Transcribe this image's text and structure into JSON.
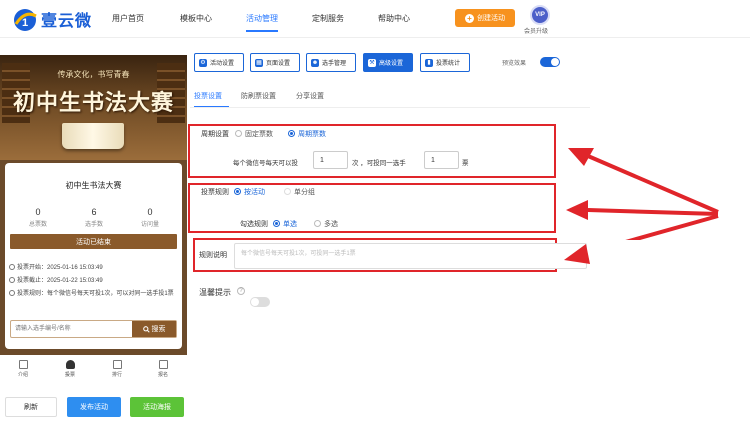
{
  "brand": {
    "name": "壹云微"
  },
  "nav": {
    "items": [
      "用户首页",
      "模板中心",
      "活动管理",
      "定制服务",
      "帮助中心"
    ],
    "active_index": 2,
    "create_label": "创建活动",
    "vip_badge": "VIP",
    "vip_label": "会员升级"
  },
  "preview": {
    "banner_sub": "传承文化，书写青春",
    "banner_title": "初中生书法大赛",
    "card_title": "初中生书法大赛",
    "stats": [
      {
        "value": "0",
        "label": "总票数"
      },
      {
        "value": "6",
        "label": "选手数"
      },
      {
        "value": "0",
        "label": "访问量"
      }
    ],
    "status_button": "活动已结束",
    "info": [
      "投票开始：2025-01-16 15:03:49",
      "投票截止：2025-01-22 15:03:49",
      "投票规则：每个微信号每天可投1次，可以对同一选手投1票"
    ],
    "search_placeholder": "请输入选手编号/名称",
    "search_button": "搜索",
    "tabs": [
      "介绍",
      "投票",
      "排行",
      "报名"
    ],
    "active_tab": 1
  },
  "bottom_buttons": {
    "refresh": "刷新",
    "publish": "发布活动",
    "poster": "活动海报"
  },
  "settings": {
    "top_buttons": [
      "活动设置",
      "页面设置",
      "选手管理",
      "高级设置",
      "投票统计"
    ],
    "active_button": 3,
    "preview_effect_label": "预览效果",
    "preview_effect_on": true,
    "subtabs": [
      "投票设置",
      "防刷票设置",
      "分享设置"
    ],
    "active_subtab": 0,
    "cycle": {
      "label": "周期设置",
      "options": [
        "固定票数",
        "周期票数"
      ],
      "selected": 1,
      "text_before": "每个微信号每天可以投",
      "votes_per_day": "1",
      "text_mid": "次 ，可投同一选手",
      "votes_same": "1",
      "text_after": "票"
    },
    "rule": {
      "label": "投票规则",
      "options": [
        "按活动",
        "单分组"
      ],
      "selected": 0,
      "check_label": "勾选规则",
      "check_options": [
        "单选",
        "多选"
      ],
      "check_selected": 0
    },
    "desc": {
      "label": "规则说明",
      "placeholder": "每个微信号每天可投1次，可投同一选手1票"
    },
    "warm": {
      "label": "温馨提示",
      "help": "?",
      "on": false
    }
  },
  "colors": {
    "accent": "#1b66d8",
    "highlight": "#e0252a",
    "orange": "#f7921e",
    "green": "#52c41a"
  }
}
